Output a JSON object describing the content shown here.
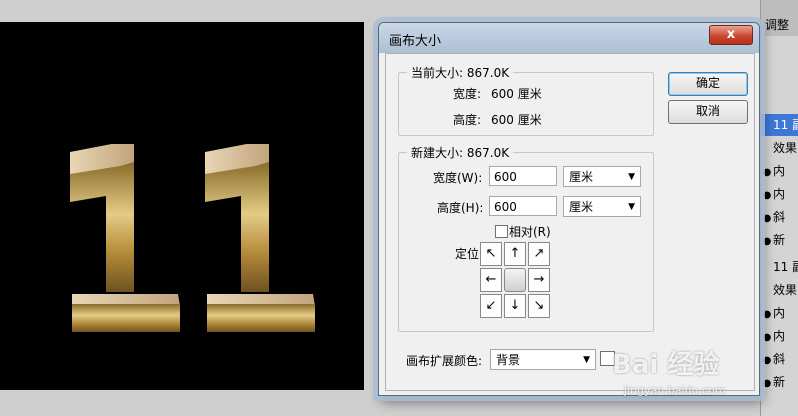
{
  "canvas": {
    "digits": [
      "1",
      "1"
    ]
  },
  "layers_panel": {
    "tab": "调整",
    "rows": [
      {
        "eye": false,
        "text": "11 副"
      },
      {
        "eye": false,
        "text": "效果"
      },
      {
        "eye": true,
        "text": "内"
      },
      {
        "eye": true,
        "text": "内"
      },
      {
        "eye": true,
        "text": "斜"
      },
      {
        "eye": true,
        "text": "新"
      },
      {
        "eye": false,
        "text": "11 副"
      },
      {
        "eye": false,
        "text": "效果"
      },
      {
        "eye": true,
        "text": "内"
      },
      {
        "eye": true,
        "text": "内"
      },
      {
        "eye": true,
        "text": "斜"
      },
      {
        "eye": true,
        "text": "新"
      }
    ]
  },
  "dialog": {
    "title": "画布大小",
    "close_symbol": "x",
    "current_size": {
      "legend": "当前大小: 867.0K",
      "width_label": "宽度:",
      "width_value": "600 厘米",
      "height_label": "高度:",
      "height_value": "600 厘米"
    },
    "new_size": {
      "legend": "新建大小: 867.0K",
      "width_label": "宽度(W):",
      "width_value": "600",
      "width_unit": "厘米",
      "height_label": "高度(H):",
      "height_value": "600",
      "height_unit": "厘米",
      "relative_label": "相对(R)",
      "relative_checked": false,
      "anchor_label": "定位:"
    },
    "extension_color": {
      "label": "画布扩展颜色:",
      "value": "背景"
    },
    "buttons": {
      "ok": "确定",
      "cancel": "取消"
    }
  },
  "watermark": {
    "brand": "Bai 经验",
    "url": "jingyan.baidu.com"
  },
  "colors": {
    "gold": "#c9a85a",
    "wood": "#d8c3a0",
    "canvas": "#000000"
  }
}
